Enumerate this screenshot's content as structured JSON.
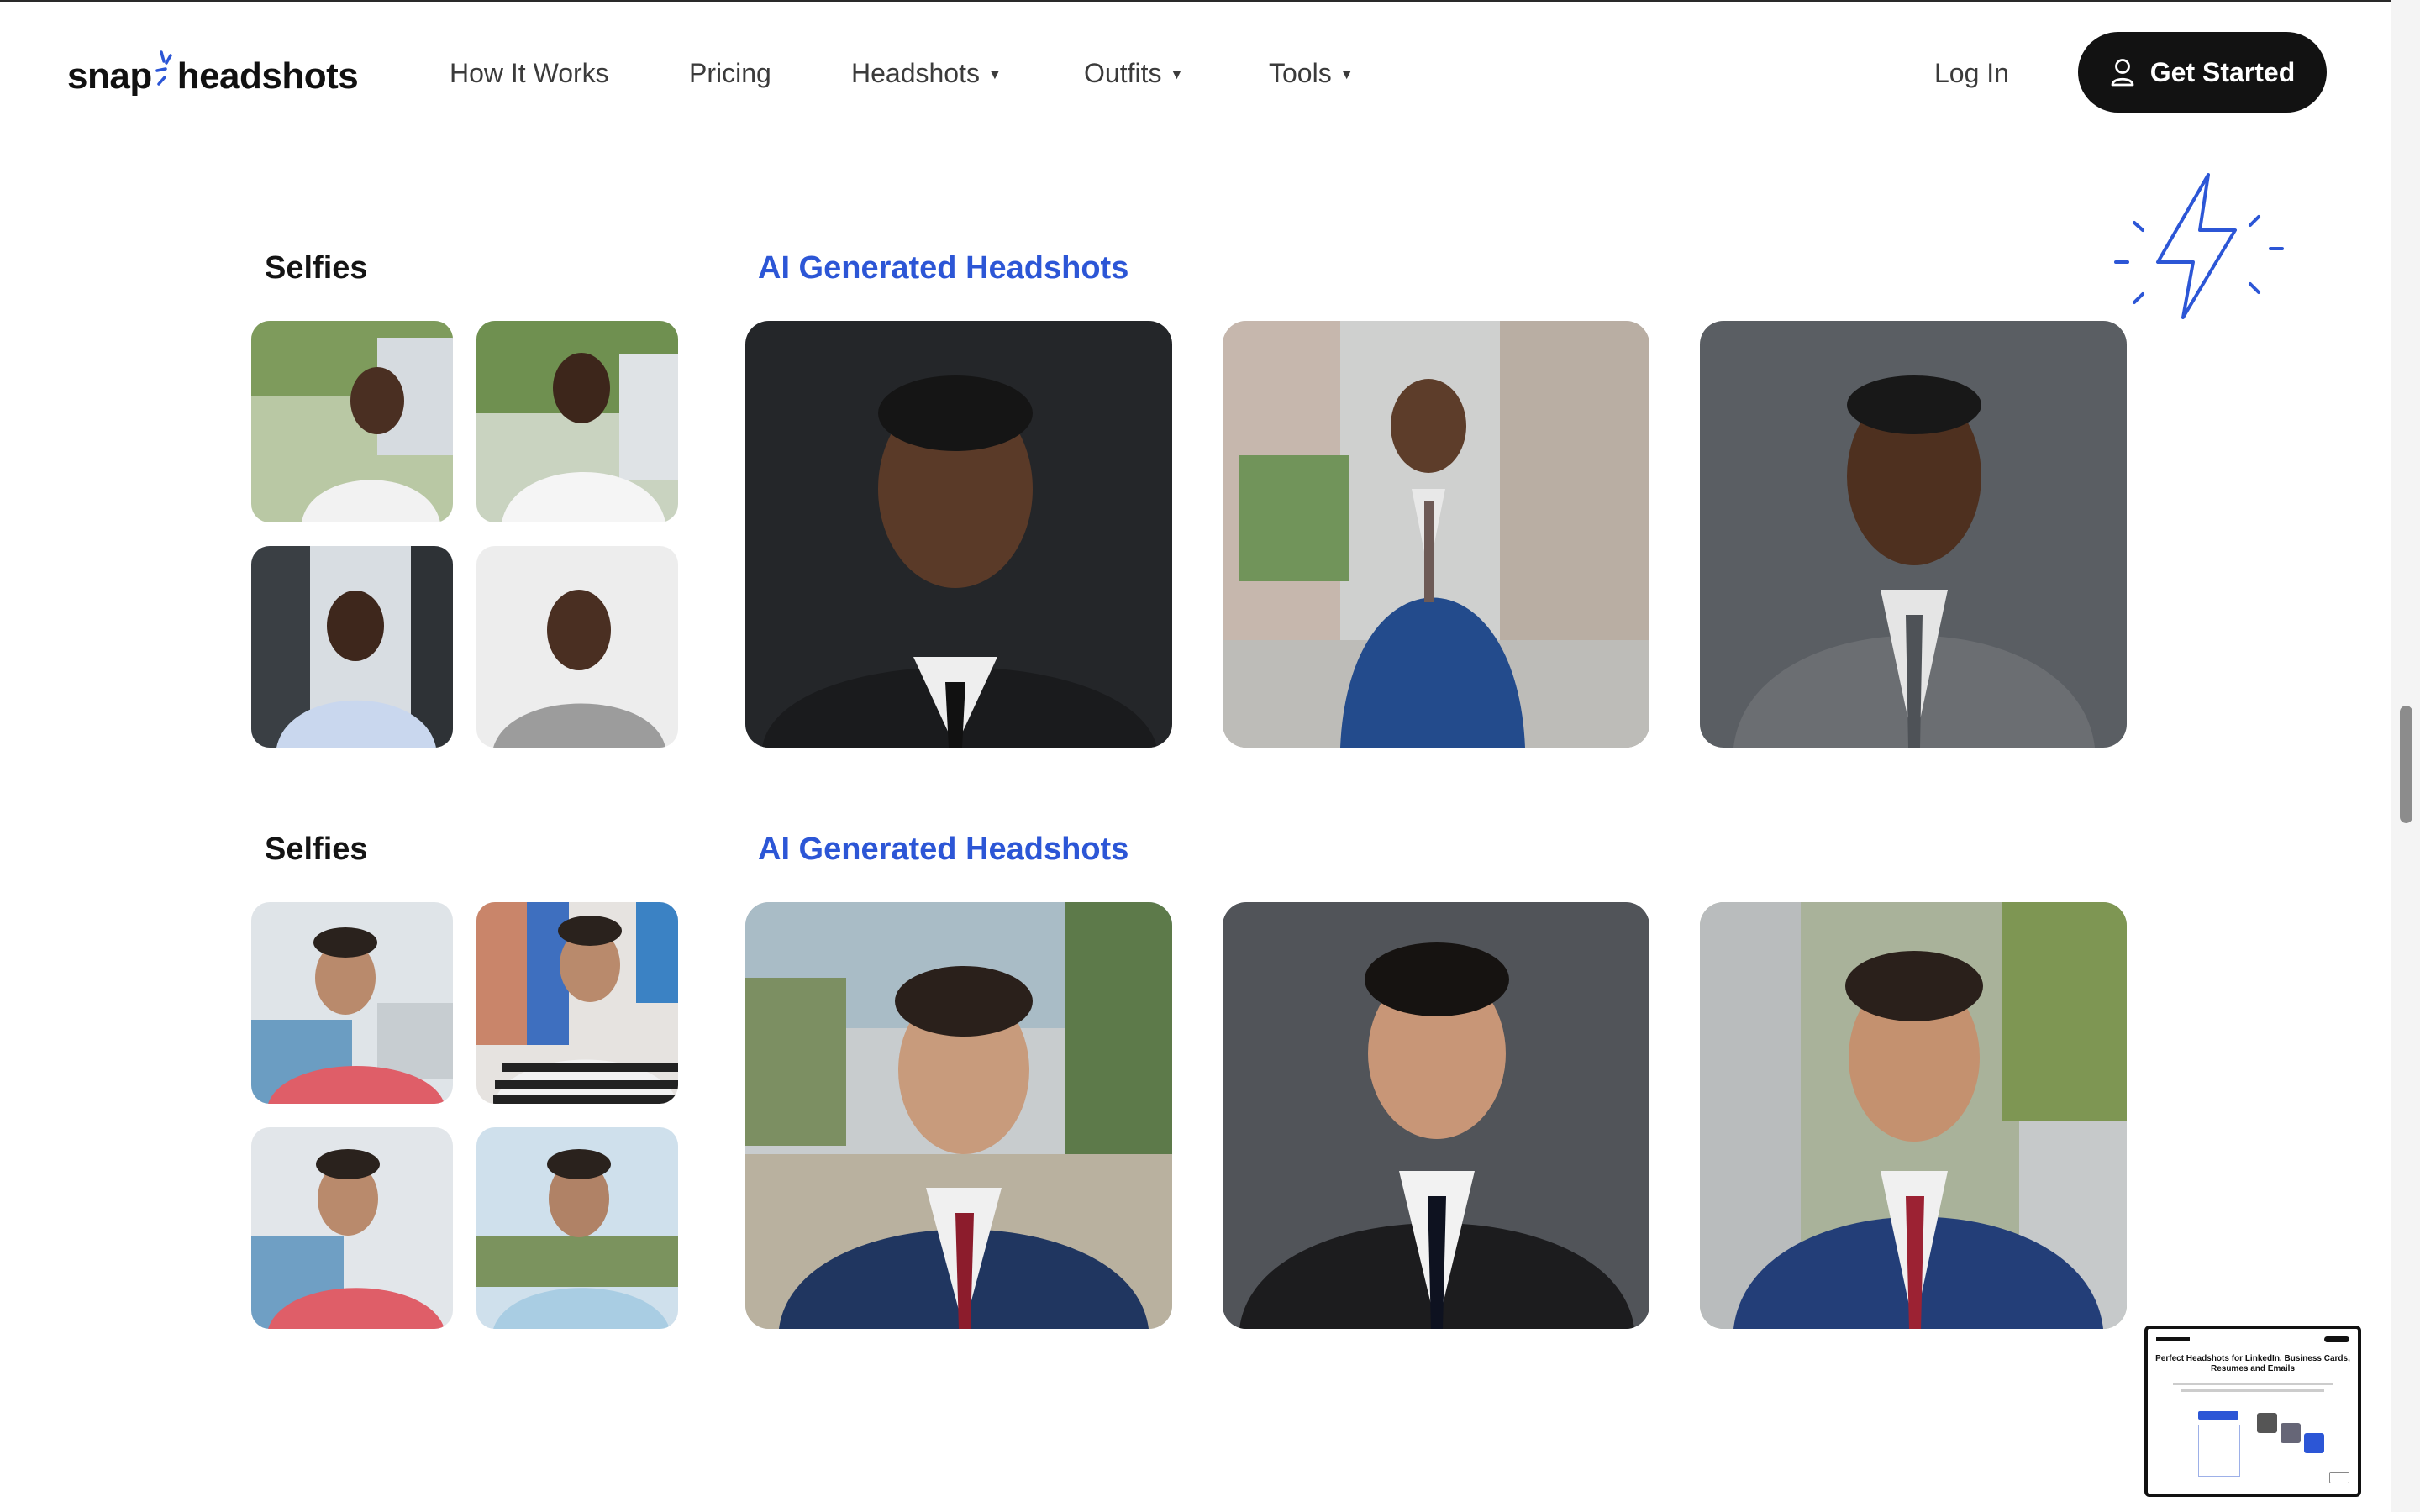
{
  "brand": {
    "name_left": "snap",
    "name_right": "headshots",
    "accent": "#2c56d6"
  },
  "nav": {
    "links": [
      {
        "label": "How It Works",
        "has_caret": false
      },
      {
        "label": "Pricing",
        "has_caret": false
      },
      {
        "label": "Headshots",
        "has_caret": true
      },
      {
        "label": "Outfits",
        "has_caret": true
      },
      {
        "label": "Tools",
        "has_caret": true
      }
    ],
    "login": "Log In",
    "cta": "Get Started",
    "cta_icon": "user-icon",
    "caret_icon": "caret-down-icon"
  },
  "sections": [
    {
      "selfies_label": "Selfies",
      "ai_label": "AI Generated Headshots",
      "selfies": [
        "selfie-photo",
        "selfie-photo",
        "selfie-photo",
        "selfie-photo"
      ],
      "headshots": [
        "headshot-photo-dark-suit",
        "headshot-photo-blue-suit-street",
        "headshot-photo-grey-suit"
      ]
    },
    {
      "selfies_label": "Selfies",
      "ai_label": "AI Generated Headshots",
      "selfies": [
        "selfie-photo",
        "selfie-photo",
        "selfie-photo",
        "selfie-photo"
      ],
      "headshots": [
        "headshot-photo-navy-suit-outdoor",
        "headshot-photo-black-suit",
        "headshot-photo-navy-suit-street"
      ]
    }
  ],
  "decor": {
    "icon": "lightning-bolt-icon"
  },
  "preview": {
    "title": "Perfect Headshots for LinkedIn, Business Cards, Resumes and Emails"
  }
}
